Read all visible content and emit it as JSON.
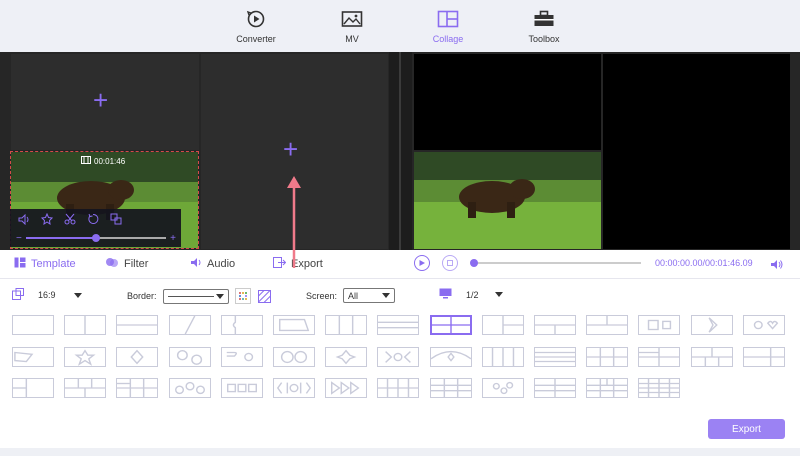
{
  "nav": {
    "items": [
      {
        "label": "Converter",
        "icon": "converter-icon"
      },
      {
        "label": "MV",
        "icon": "mv-icon"
      },
      {
        "label": "Collage",
        "icon": "collage-icon",
        "active": true
      },
      {
        "label": "Toolbox",
        "icon": "toolbox-icon"
      }
    ]
  },
  "preview": {
    "clip_time": "00:01:46",
    "volume_fraction": 0.5
  },
  "tabs": {
    "template": "Template",
    "filter": "Filter",
    "audio": "Audio",
    "export": "Export"
  },
  "player": {
    "timecode": "00:00:00.00/00:01:46.09",
    "progress_fraction": 0.0
  },
  "options": {
    "aspect_value": "16:9",
    "border_label": "Border:",
    "screen_label": "Screen:",
    "screen_value": "All",
    "page_value": "1/2"
  },
  "export_button": "Export",
  "colors": {
    "accent": "#8a6cf0",
    "border_pattern": "#d44a4a"
  }
}
